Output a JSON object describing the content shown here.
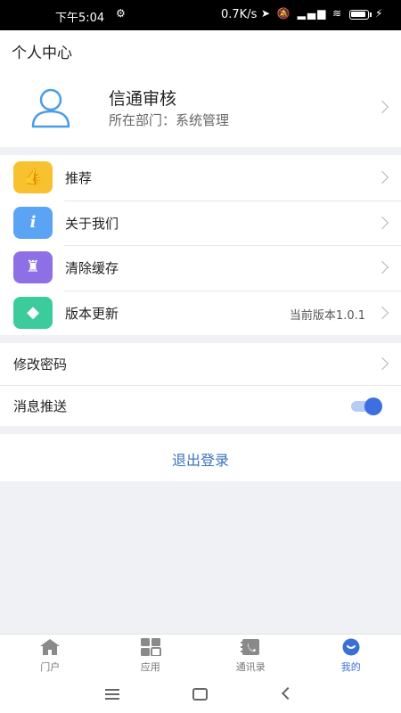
{
  "status_bar": {
    "time": "下午5:04",
    "settings_glyph": "⚙",
    "network_speed": "0.7K/s",
    "icons": "➤ 🔕 ▂▄▆ ≋"
  },
  "header": {
    "title": "个人中心"
  },
  "profile": {
    "name": "信通审核",
    "department": "所在部门：系统管理"
  },
  "menu": {
    "items": [
      {
        "label": "推荐",
        "icon": "thumbs-up-icon",
        "icon_glyph": "👍",
        "color": "#f7c12f"
      },
      {
        "label": "关于我们",
        "icon": "info-icon",
        "icon_glyph": "i",
        "color": "#5aa3f5"
      },
      {
        "label": "清除缓存",
        "icon": "broom-icon",
        "icon_glyph": "♜",
        "color": "#8e70e6"
      },
      {
        "label": "版本更新",
        "icon": "diamond-icon",
        "icon_glyph": "◆",
        "color": "#3ccb9a",
        "value": "当前版本1.0.1"
      }
    ]
  },
  "settings": {
    "change_password": "修改密码",
    "push_notifications": "消息推送",
    "push_enabled": true
  },
  "logout": {
    "label": "退出登录",
    "color": "#3b73b9"
  },
  "tabs": [
    {
      "label": "门户",
      "icon": "home-icon"
    },
    {
      "label": "应用",
      "icon": "apps-grid-icon"
    },
    {
      "label": "通讯录",
      "icon": "contacts-icon"
    },
    {
      "label": "我的",
      "icon": "profile-icon",
      "active": true
    }
  ],
  "accent_color": "#3a6fd8"
}
